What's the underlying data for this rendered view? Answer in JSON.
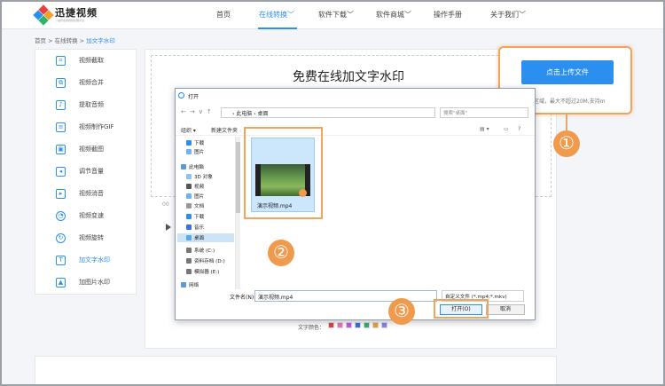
{
  "nav": {
    "brand": "迅捷视频",
    "brand_sub": "—站式在线视频处理平台",
    "items": [
      {
        "label": "首页",
        "active": false
      },
      {
        "label": "在线转换﹀",
        "active": true
      },
      {
        "label": "软件下载﹀",
        "active": false
      },
      {
        "label": "软件商城﹀",
        "active": false
      },
      {
        "label": "操作手册",
        "active": false
      },
      {
        "label": "关于我们﹀",
        "active": false
      }
    ]
  },
  "breadcrumb": {
    "parts": [
      "首页",
      "在线转换",
      "加文字水印"
    ],
    "sep": " > "
  },
  "sidebar": {
    "items": [
      {
        "label": "视频截取",
        "icon": "crop-icon"
      },
      {
        "label": "视频合并",
        "icon": "merge-icon"
      },
      {
        "label": "提取音频",
        "icon": "audio-icon"
      },
      {
        "label": "视频制作GIF",
        "icon": "gif-icon"
      },
      {
        "label": "视频截图",
        "icon": "screenshot-icon"
      },
      {
        "label": "调节音量",
        "icon": "volume-icon"
      },
      {
        "label": "视频消音",
        "icon": "mute-icon"
      },
      {
        "label": "视频变速",
        "icon": "speed-icon"
      },
      {
        "label": "视频旋转",
        "icon": "rotate-icon"
      },
      {
        "label": "加文字水印",
        "icon": "text-watermark-icon",
        "active": true
      },
      {
        "label": "加图片水印",
        "icon": "image-watermark-icon"
      }
    ]
  },
  "main": {
    "title": "免费在线加文字水印",
    "left_mark": "00",
    "color_label": "文字颜色："
  },
  "upload": {
    "button": "点击上传文件",
    "hint": "拖拽视频至此区域，最大不超过20M,支持m"
  },
  "dialog": {
    "title": "打开",
    "address": "›  此电脑  ›  桌面",
    "search_placeholder": "搜索\"桌面\"",
    "toolbar": [
      "组织 ▾",
      "新建文件夹"
    ],
    "tree": [
      "下载",
      "图片",
      "此电脑",
      "3D 对象",
      "视频",
      "图片",
      "文档",
      "下载",
      "音乐",
      "桌面",
      "系统 (C:)",
      "资料存档 (D:)",
      "模拟器 (E:)",
      "网络"
    ],
    "file_name": "演示视频.mp4",
    "filename_label": "文件名(N):",
    "filename_value": "演示视频.mp4",
    "type_value": "自定义文件 (*.mp4;*.mkv)",
    "open_button": "打开(O)",
    "cancel_button": "取消"
  },
  "badges": [
    "①",
    "②",
    "③"
  ],
  "colors": {
    "accent": "#2b8ff0",
    "highlight": "#f1a45c",
    "badge": "#f09a4e",
    "swatches": [
      "#e6413e",
      "#f66fbf",
      "#c957e9",
      "#3a6fe8",
      "#2fb36b",
      "#f1a12f",
      "#8c7ef0"
    ]
  }
}
